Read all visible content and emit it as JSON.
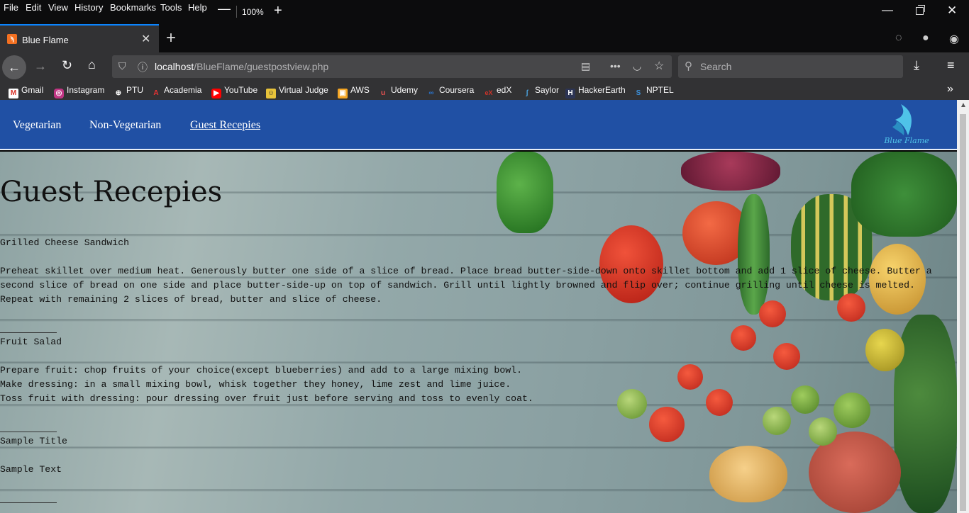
{
  "menubar": {
    "items": [
      "File",
      "Edit",
      "View",
      "History",
      "Bookmarks",
      "Tools",
      "Help"
    ],
    "zoom": "100%"
  },
  "tab": {
    "title": "Blue Flame",
    "favicon": "xampp-icon"
  },
  "urlbar": {
    "host": "localhost",
    "path": "/BlueFlame/guestpostview.php"
  },
  "searchbar": {
    "placeholder": "Search"
  },
  "bookmarks": [
    "Gmail",
    "Instagram",
    "PTU",
    "Academia",
    "YouTube",
    "Virtual Judge",
    "AWS",
    "Udemy",
    "Coursera",
    "edX",
    "Saylor",
    "HackerEarth",
    "NPTEL"
  ],
  "site": {
    "nav": [
      "Vegetarian",
      "Non-Vegetarian",
      "Guest Recepies"
    ],
    "logo_text": "Blue Flame",
    "accent": "#2050a4"
  },
  "page": {
    "heading": "Guest Recepies",
    "posts": [
      {
        "title": "Grilled Cheese Sandwich",
        "lines": [
          "Preheat skillet over medium heat. Generously butter one side of a slice of bread. Place bread butter-side-down onto skillet bottom and add 1 slice of cheese. Butter a",
          "second slice of bread on one side and place butter-side-up on top of sandwich. Grill until lightly browned and flip over; continue grilling until cheese is melted.",
          "Repeat with remaining 2 slices of bread, butter and slice of cheese."
        ]
      },
      {
        "title": "Fruit Salad",
        "lines": [
          "Prepare fruit: chop fruits of your choice(except blueberries) and add to a large mixing bowl.",
          "Make dressing: in a small mixing bowl, whisk together they honey, lime zest and lime juice.",
          "Toss fruit with dressing: pour dressing over fruit just before serving and toss to evenly coat."
        ]
      },
      {
        "title": "Sample Title",
        "lines": [
          "Sample Text"
        ]
      }
    ]
  }
}
